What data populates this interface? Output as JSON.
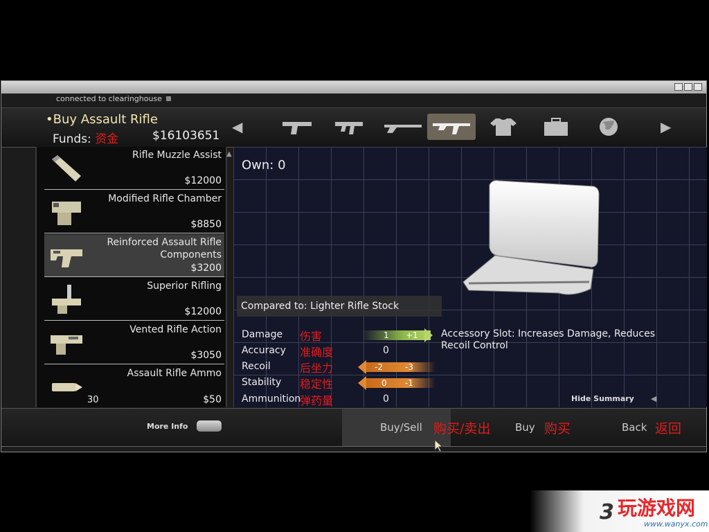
{
  "window": {
    "connection_status": "connected to clearinghouse"
  },
  "header": {
    "title": "Buy Assault Rifle",
    "funds_label": "Funds:",
    "funds_cn": "资金",
    "funds_value": "$16103651"
  },
  "categories": [
    {
      "icon": "pistol-icon",
      "selected": false
    },
    {
      "icon": "smg-icon",
      "selected": false
    },
    {
      "icon": "shotgun-icon",
      "selected": false
    },
    {
      "icon": "assault-rifle-icon",
      "selected": true
    },
    {
      "icon": "shirt-icon",
      "selected": false
    },
    {
      "icon": "briefcase-icon",
      "selected": false
    },
    {
      "icon": "globe-icon",
      "selected": false
    }
  ],
  "items": [
    {
      "name": "Rifle Muzzle Assist",
      "price": "$12000",
      "qty": "",
      "icon": "muzzle-icon"
    },
    {
      "name": "Modified Rifle Chamber",
      "price": "$8850",
      "qty": "",
      "icon": "chamber-icon"
    },
    {
      "name": "Reinforced Assault Rifle Components",
      "price": "$3200",
      "qty": "",
      "icon": "components-icon",
      "selected": true
    },
    {
      "name": "Superior Rifling",
      "price": "$12000",
      "qty": "",
      "icon": "rifling-icon"
    },
    {
      "name": "Vented Rifle Action",
      "price": "$3050",
      "qty": "",
      "icon": "action-icon"
    },
    {
      "name": "Assault Rifle Ammo",
      "price": "$50",
      "qty": "30",
      "icon": "ammo-icon"
    }
  ],
  "detail": {
    "own": "Own: 0",
    "compared_to": "Compared to: Lighter Rifle Stock",
    "description": "Accessory Slot: Increases Damage, Reduces Recoil Control",
    "hide_summary": "Hide Summary",
    "stats": [
      {
        "label": "Damage",
        "cn": "伤害",
        "base": "1",
        "delta": "+1",
        "kind": "green"
      },
      {
        "label": "Accuracy",
        "cn": "准确度",
        "base": "0",
        "delta": "",
        "kind": "none"
      },
      {
        "label": "Recoil",
        "cn": "后坐力",
        "base": "-2",
        "delta": "-3",
        "kind": "orange"
      },
      {
        "label": "Stability",
        "cn": "稳定性",
        "base": "0",
        "delta": "-1",
        "kind": "orange"
      },
      {
        "label": "Ammunition",
        "cn": "弹药量",
        "base": "0",
        "delta": "",
        "kind": "none"
      }
    ]
  },
  "bottom": {
    "more_info": "More Info",
    "buy_sell": "Buy/Sell",
    "buy_sell_cn": "购买/卖出",
    "buy": "Buy",
    "buy_cn": "购买",
    "back": "Back",
    "back_cn": "返回"
  },
  "watermark": {
    "text": "玩游戏网",
    "num": "3",
    "url": "www.wanyx.com"
  }
}
